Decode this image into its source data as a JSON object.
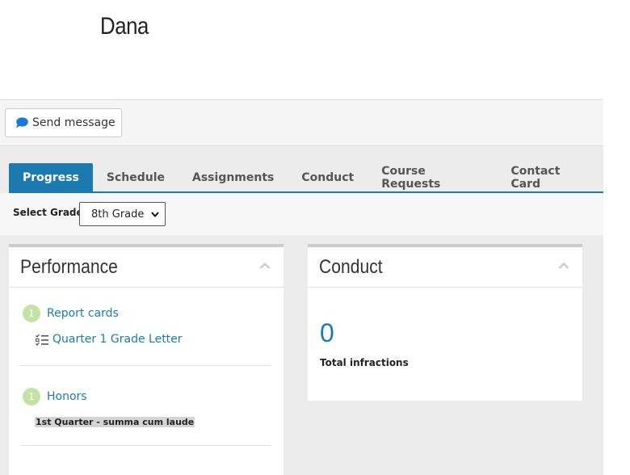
{
  "student": {
    "name": "Dana"
  },
  "actions": {
    "send_message": "Send message"
  },
  "tabs": [
    {
      "label": "Progress",
      "active": true
    },
    {
      "label": "Schedule"
    },
    {
      "label": "Assignments"
    },
    {
      "label": "Conduct"
    },
    {
      "label": "Course Requests"
    },
    {
      "label": "Contact Card"
    }
  ],
  "grade": {
    "label": "Select Grade:",
    "selected": "8th Grade"
  },
  "performance": {
    "title": "Performance",
    "report_cards": {
      "count": "1",
      "label": "Report cards",
      "item": "Quarter 1 Grade Letter"
    },
    "honors": {
      "count": "1",
      "label": "Honors",
      "item": "1st Quarter - summa cum laude"
    }
  },
  "conduct": {
    "title": "Conduct",
    "infractions": "0",
    "infractions_label": "Total infractions"
  },
  "colors": {
    "accent": "#1b7bb0",
    "badge": "#c3e2a4",
    "panel_bg": "#ececec"
  }
}
